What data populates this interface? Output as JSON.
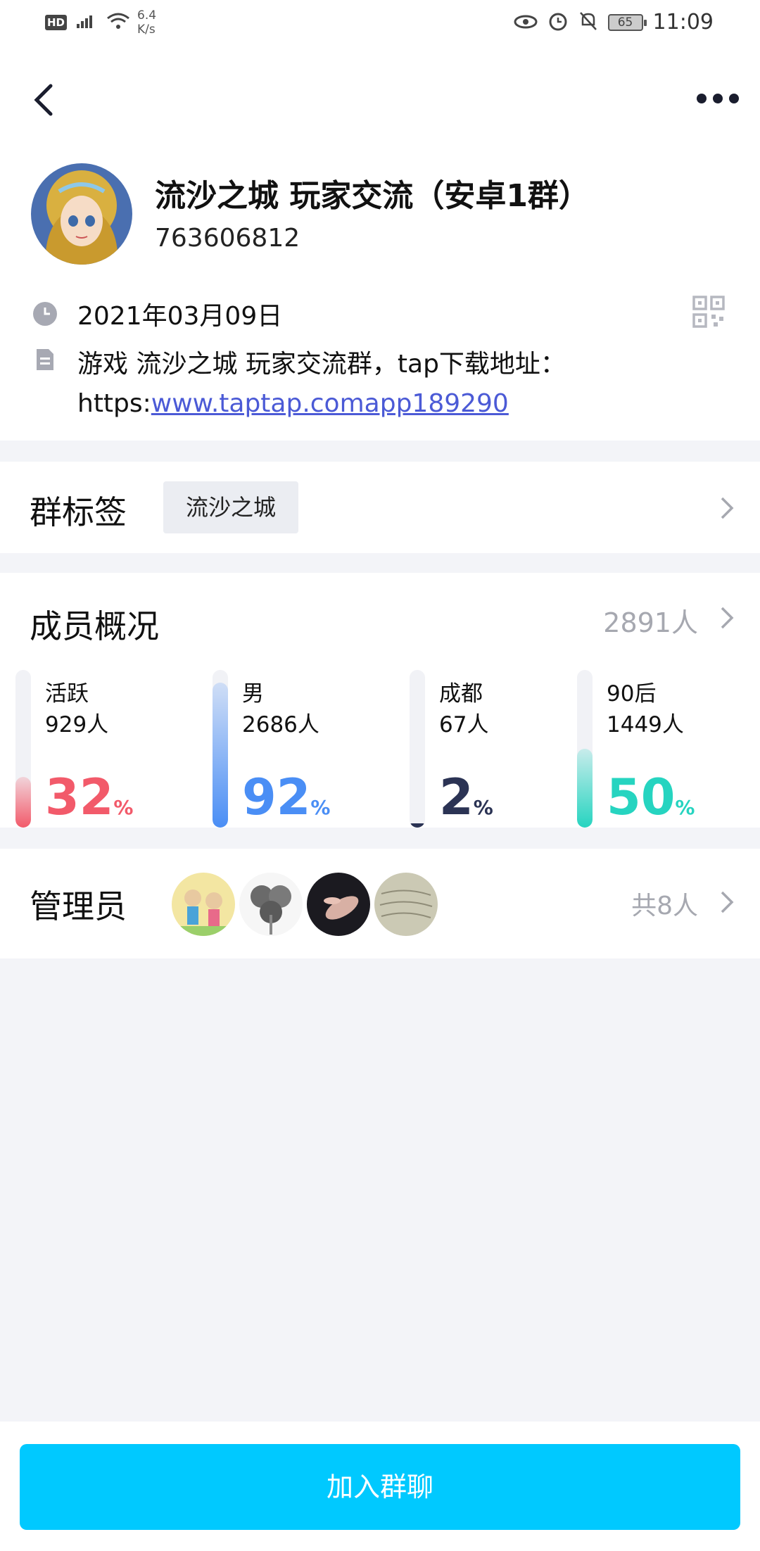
{
  "status_bar": {
    "hd": "HD",
    "network": "4G",
    "speed_value": "6.4",
    "speed_unit": "K/s",
    "battery": "65",
    "time": "11:09"
  },
  "header": {
    "title": "流沙之城 玩家交流（安卓1群）",
    "group_id": "763606812"
  },
  "info": {
    "date": "2021年03月09日",
    "desc_text": "游戏 流沙之城 玩家交流群，tap下载地址：",
    "desc_prefix": "https:",
    "desc_link": "www.taptap.comapp189290"
  },
  "tags": {
    "title": "群标签",
    "items": [
      "流沙之城"
    ]
  },
  "members": {
    "title": "成员概况",
    "count": "2891人",
    "stats": [
      {
        "label": "活跃",
        "count": "929人",
        "percent": "32",
        "unit": "%",
        "fill": 0.32,
        "color": "#f25a6a"
      },
      {
        "label": "男",
        "count": "2686人",
        "percent": "92",
        "unit": "%",
        "fill": 0.92,
        "color": "#4a8ef5"
      },
      {
        "label": "成都",
        "count": "67人",
        "percent": "2",
        "unit": "%",
        "fill": 0.02,
        "color": "#2b3354"
      },
      {
        "label": "90后",
        "count": "1449人",
        "percent": "50",
        "unit": "%",
        "fill": 0.5,
        "color": "#26d4c0"
      }
    ]
  },
  "admins": {
    "title": "管理员",
    "total": "共8人"
  },
  "footer": {
    "join_label": "加入群聊"
  },
  "colors": {
    "accent": "#00c9ff",
    "link": "#4b5ad6",
    "muted": "#a6a8b0",
    "background": "#f3f4f8"
  }
}
